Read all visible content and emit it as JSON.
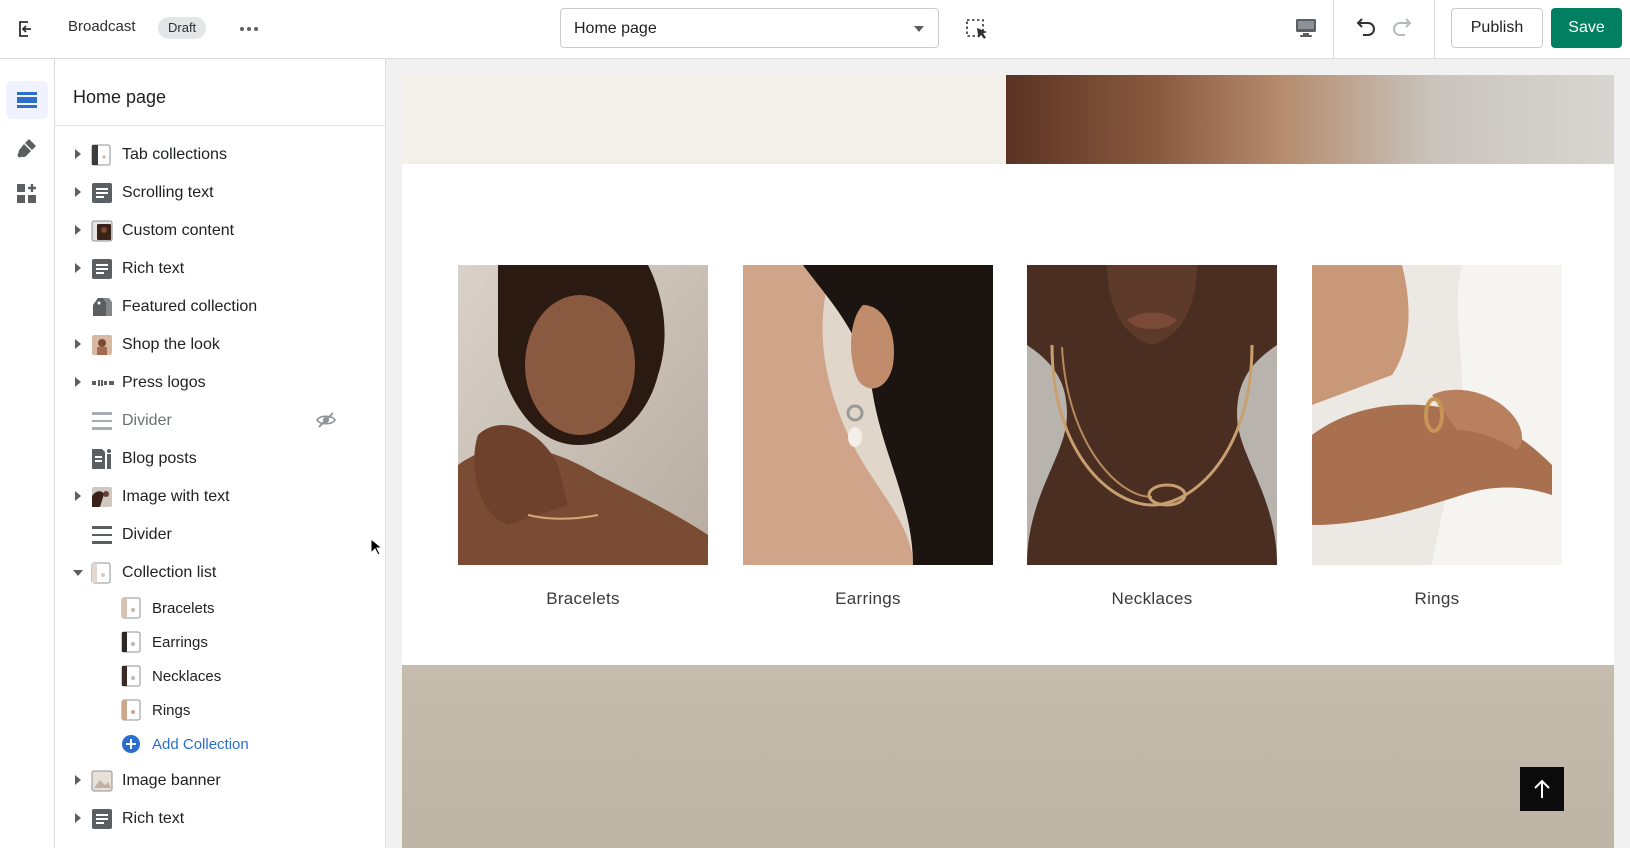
{
  "topbar": {
    "theme_name": "Broadcast",
    "status_badge": "Draft",
    "page_select_value": "Home page",
    "publish_label": "Publish",
    "save_label": "Save"
  },
  "rail": {
    "items": [
      "sections-icon",
      "theme-settings-icon",
      "app-embeds-icon"
    ]
  },
  "sidebar": {
    "title": "Home page",
    "sections": [
      {
        "label": "Tab collections"
      },
      {
        "label": "Scrolling text"
      },
      {
        "label": "Custom content"
      },
      {
        "label": "Rich text"
      },
      {
        "label": "Featured collection"
      },
      {
        "label": "Shop the look"
      },
      {
        "label": "Press logos"
      },
      {
        "label": "Divider",
        "hidden": true
      },
      {
        "label": "Blog posts"
      },
      {
        "label": "Image with text"
      },
      {
        "label": "Divider"
      },
      {
        "label": "Collection list",
        "expanded": true
      },
      {
        "label": "Image banner"
      },
      {
        "label": "Rich text"
      }
    ],
    "collection_blocks": [
      {
        "label": "Bracelets"
      },
      {
        "label": "Earrings"
      },
      {
        "label": "Necklaces"
      },
      {
        "label": "Rings"
      }
    ],
    "add_block_label": "Add Collection"
  },
  "preview": {
    "collections": [
      {
        "title": "Bracelets"
      },
      {
        "title": "Earrings"
      },
      {
        "title": "Necklaces"
      },
      {
        "title": "Rings"
      }
    ]
  },
  "colors": {
    "primary": "#008060",
    "link": "#2c6ecb",
    "rail_active": "#2c6ecb"
  }
}
